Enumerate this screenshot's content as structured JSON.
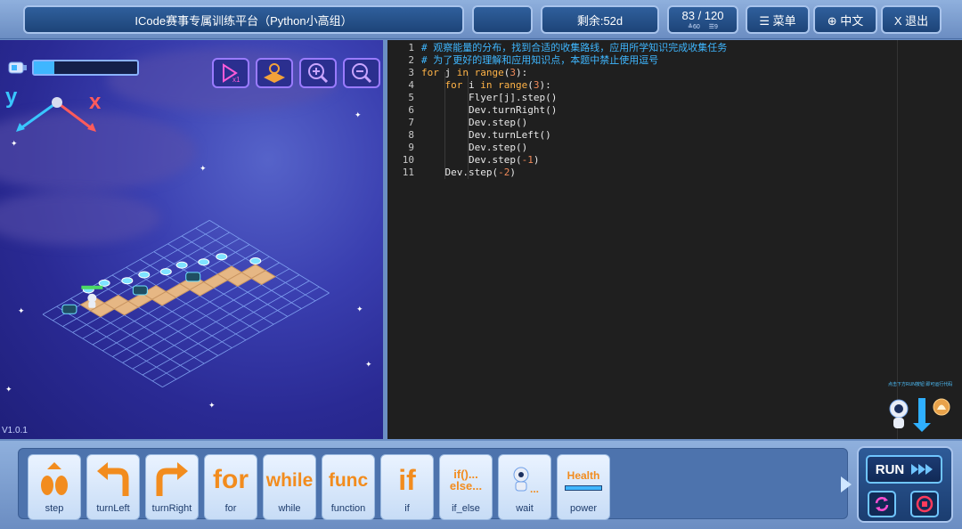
{
  "topbar": {
    "title": "ICode赛事专属训练平台（Python小高组）",
    "remaining": "剩余:52d",
    "progress": "83 / 120",
    "progress_sub_a": "≙60",
    "progress_sub_b": "☰9",
    "menu_label": "☰ 菜单",
    "lang_label": "⊕ 中文",
    "exit_label": "X 退出"
  },
  "game": {
    "energy_fraction": 0.2,
    "axis_y": "y",
    "axis_x": "x",
    "version": "V1.0.1",
    "tools": [
      "speed-x1-icon",
      "map-view-icon",
      "zoom-in-icon",
      "zoom-out-icon"
    ]
  },
  "editor": {
    "line_numbers": [
      "1",
      "2",
      "3",
      "4",
      "5",
      "6",
      "7",
      "8",
      "9",
      "10",
      "11"
    ],
    "lines": [
      "# 观察能量的分布，找到合适的收集路线，应用所学知识完成收集任务",
      "# 为了更好的理解和应用知识点，本题中禁止使用逗号",
      "for j in range(3):",
      "    for i in range(3):",
      "        Flyer[j].step()",
      "        Dev.turnRight()",
      "        Dev.step()",
      "        Dev.turnLeft()",
      "        Dev.step()",
      "        Dev.step(-1)",
      "    Dev.step(-2)"
    ],
    "robot_tip": "点击下方RUN按钮\n即可运行代码"
  },
  "blocks": [
    {
      "label": "step",
      "art": "step-icon"
    },
    {
      "label": "turnLeft",
      "art": "turn-left-icon"
    },
    {
      "label": "turnRight",
      "art": "turn-right-icon"
    },
    {
      "label": "for",
      "art": "for"
    },
    {
      "label": "while",
      "art": "while"
    },
    {
      "label": "function",
      "art": "func"
    },
    {
      "label": "if",
      "art": "if"
    },
    {
      "label": "if_else",
      "art": "if()...\nelse..."
    },
    {
      "label": "wait",
      "art": "wait-icon"
    },
    {
      "label": "power",
      "art": "Health"
    }
  ],
  "run": {
    "label": "RUN",
    "colors": {
      "accent": "#6fc5ff",
      "stop": "#ff3b5c"
    }
  }
}
